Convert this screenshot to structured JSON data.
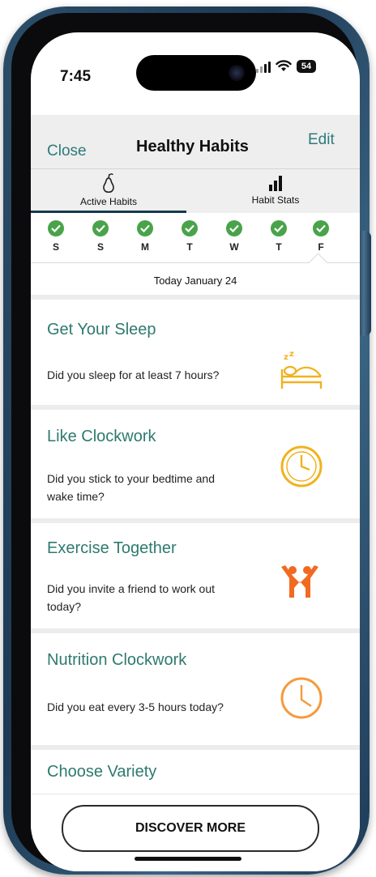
{
  "status": {
    "time": "7:45",
    "battery": "54"
  },
  "header": {
    "close_label": "Close",
    "title": "Healthy Habits",
    "edit_label": "Edit"
  },
  "tabs": [
    {
      "label": "Active Habits",
      "icon": "pear-icon",
      "active": true
    },
    {
      "label": "Habit Stats",
      "icon": "bar-chart-icon",
      "active": false
    }
  ],
  "days": [
    {
      "letter": "S",
      "completed": true
    },
    {
      "letter": "S",
      "completed": true
    },
    {
      "letter": "M",
      "completed": true
    },
    {
      "letter": "T",
      "completed": true
    },
    {
      "letter": "W",
      "completed": true
    },
    {
      "letter": "T",
      "completed": true
    },
    {
      "letter": "F",
      "completed": true,
      "selected": true
    }
  ],
  "date_label": "Today January 24",
  "habits": [
    {
      "title": "Get Your Sleep",
      "question": "Did you sleep for at least 7 hours?",
      "icon": "bed-sleep-icon",
      "icon_color": "#f0b21e"
    },
    {
      "title": "Like Clockwork",
      "question": "Did you stick to your bedtime and wake time?",
      "icon": "clock-icon",
      "icon_color": "#f0b21e"
    },
    {
      "title": "Exercise Together",
      "question": "Did you invite a friend to work out today?",
      "icon": "people-exercise-icon",
      "icon_color": "#f26a21"
    },
    {
      "title": "Nutrition Clockwork",
      "question": "Did you eat every 3-5 hours today?",
      "icon": "clock-icon",
      "icon_color": "#f59a3a"
    },
    {
      "title": "Choose Variety"
    }
  ],
  "discover_label": "DISCOVER MORE",
  "colors": {
    "accent_teal": "#2e7a6e",
    "check_green": "#49a34a",
    "frame_blue": "#1d3a55"
  }
}
